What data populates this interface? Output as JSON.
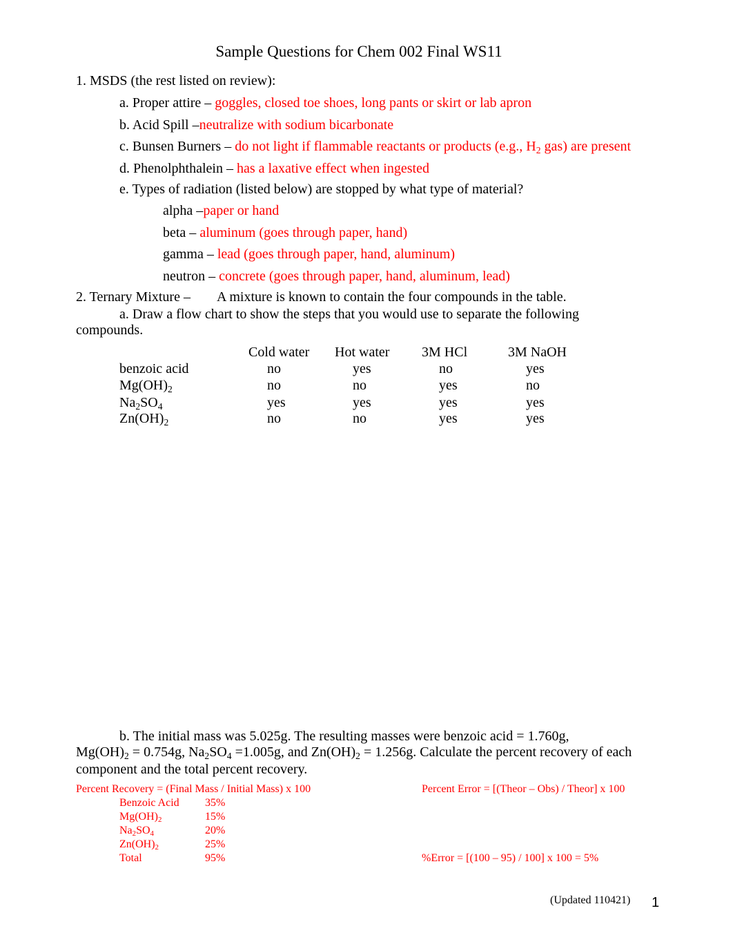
{
  "title": "Sample Questions for Chem 002 Final WS11",
  "q1": {
    "heading": "1.  MSDS (the rest listed on review):",
    "items": [
      {
        "label": "a.  Proper attire – ",
        "answer": "goggles, closed toe shoes, long pants or skirt or lab apron"
      },
      {
        "label": "b.  Acid Spill –",
        "answer": "neutralize with sodium bicarbonate"
      },
      {
        "label": "c.  Bunsen Burners – ",
        "answer_pre": "do not light if flammable reactants or products (e.g., H",
        "answer_sub": "2",
        "answer_post": " gas) are present"
      },
      {
        "label": "d.  Phenolphthalein – ",
        "answer": "has a laxative effect when ingested"
      },
      {
        "label": "e.  Types of radiation (listed below) are stopped by what type of material?"
      }
    ],
    "radiation": [
      {
        "type": "alpha –",
        "answer": "paper or hand"
      },
      {
        "type": "beta – ",
        "answer": "aluminum (goes through paper, hand)"
      },
      {
        "type": "gamma – ",
        "answer": "lead (goes through paper, hand, aluminum)"
      },
      {
        "type": "neutron – ",
        "answer": "concrete (goes through paper, hand, aluminum, lead)"
      }
    ]
  },
  "q2": {
    "heading": "2.  Ternary Mixture –",
    "heading_text": "A mixture is known to contain the four compounds in the table.",
    "part_a_line1": "a.  Draw a flow chart to show the steps that you would use to separate the following",
    "part_a_line2": "compounds.",
    "table": {
      "columns": [
        "Cold water",
        "Hot water",
        "3M HCl",
        "3M NaOH"
      ],
      "rows": [
        {
          "compound": "benzoic acid",
          "values": [
            "no",
            "yes",
            "no",
            "yes"
          ]
        },
        {
          "compound": "Mg(OH)",
          "sub": "2",
          "values": [
            "no",
            "no",
            "yes",
            "no"
          ]
        },
        {
          "compound": "Na",
          "sub": "2",
          "compound_post": "SO",
          "sub2": "4",
          "values": [
            "yes",
            "yes",
            "yes",
            "yes"
          ]
        },
        {
          "compound": "Zn(OH)",
          "sub": "2",
          "values": [
            "no",
            "no",
            "yes",
            "yes"
          ]
        }
      ]
    },
    "part_b": {
      "line1": "b.  The initial mass was 5.025g.  The resulting masses were benzoic acid = 1.760g,",
      "line2_parts": [
        "Mg(OH)",
        "2",
        " = 0.754g, Na",
        "2",
        "SO",
        "4",
        " =1.005g, and Zn(OH)",
        "2",
        " = 1.256g.  Calculate the percent recovery of each"
      ],
      "line3": "component and the total percent recovery."
    },
    "answers": {
      "recovery_formula": "Percent Recovery = (Final Mass / Initial Mass) x 100",
      "error_formula": "Percent Error = [(Theor – Obs) / Theor] x 100",
      "recovery": [
        {
          "name": "Benzoic Acid",
          "value": "35%"
        },
        {
          "name": "Mg(OH)",
          "sub": "2",
          "value": "15%"
        },
        {
          "name": "Na",
          "sub": "2",
          "name_post": "SO",
          "sub2": "4",
          "value": "20%"
        },
        {
          "name": "Zn(OH)",
          "sub": "2",
          "value": "25%"
        },
        {
          "name": "Total",
          "value": "95%"
        }
      ],
      "error_calc": "%Error = [(100 – 95) / 100] x 100 = 5%"
    }
  },
  "footer": {
    "updated": "(Updated 110421)",
    "page_number": "1"
  }
}
